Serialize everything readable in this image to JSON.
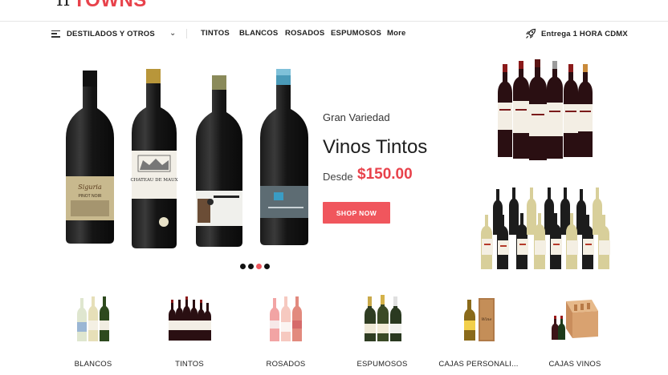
{
  "header": {
    "logo_mark": "II",
    "logo_text": "TOWNS"
  },
  "nav": {
    "category_button_label": "DESTILADOS Y OTROS",
    "links": [
      "TINTOS",
      "BLANCOS",
      "ROSADOS",
      "ESPUMOSOS",
      "More"
    ],
    "delivery_text": "Entrega 1 HORA CDMX",
    "icons": [
      "hamburger-icon",
      "chevron-down-icon",
      "rocket-icon"
    ]
  },
  "hero": {
    "eyebrow": "Gran Variedad",
    "title": "Vinos Tintos",
    "from_label": "Desde",
    "price": "$150.00",
    "cta": "SHOP NOW",
    "slides": 4,
    "active_slide": 3,
    "bottle_labels": [
      "Siguria PINOT NOIR",
      "CHATEAU DE MAUX",
      "",
      ""
    ]
  },
  "categories": [
    {
      "name": "BLANCOS"
    },
    {
      "name": "TINTOS"
    },
    {
      "name": "ROSADOS"
    },
    {
      "name": "ESPUMOSOS"
    },
    {
      "name": "CAJAS PERSONALI..."
    },
    {
      "name": "CAJAS VINOS"
    }
  ],
  "colors": {
    "accent": "#e8424b",
    "button": "#f0565d",
    "text": "#222222"
  }
}
